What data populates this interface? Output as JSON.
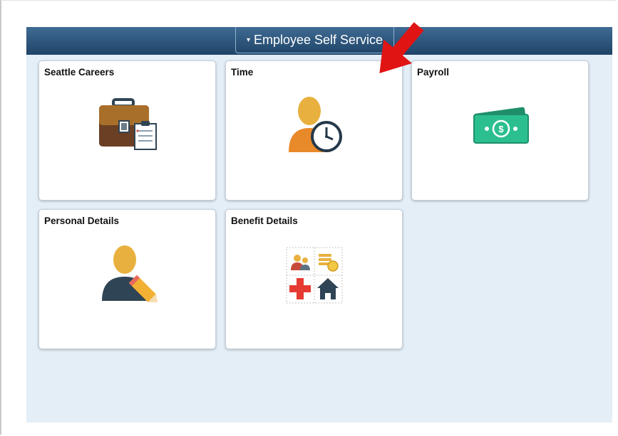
{
  "banner": {
    "homepage_title": "Employee Self Service",
    "caret": "▾"
  },
  "tiles": [
    {
      "title": "Seattle Careers",
      "icon": "briefcase-clipboard-icon"
    },
    {
      "title": "Time",
      "icon": "person-clock-icon"
    },
    {
      "title": "Payroll",
      "icon": "money-icon"
    },
    {
      "title": "Personal Details",
      "icon": "person-pencil-icon"
    },
    {
      "title": "Benefit Details",
      "icon": "benefits-grid-icon"
    }
  ],
  "colors": {
    "banner_top": "#3f6b93",
    "banner_bottom": "#1f4467",
    "canvas": "#e4eef7",
    "annotation_arrow": "#e11414"
  }
}
